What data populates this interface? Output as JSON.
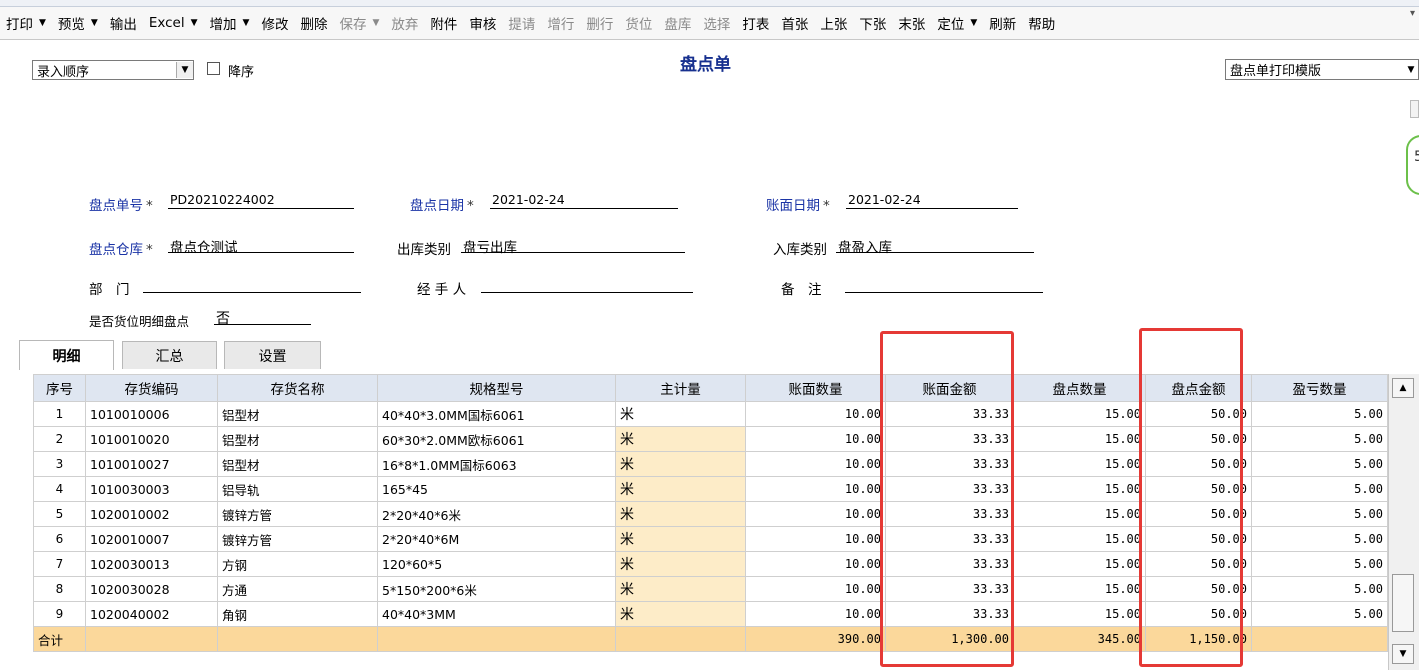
{
  "toolbar": [
    {
      "label": "打印",
      "dropdown": true,
      "disabled": false,
      "name": "print-button"
    },
    {
      "label": "预览",
      "dropdown": true,
      "disabled": false,
      "name": "preview-button"
    },
    {
      "label": "输出",
      "dropdown": false,
      "disabled": false,
      "name": "export-button"
    },
    {
      "label": "Excel",
      "dropdown": true,
      "disabled": false,
      "name": "excel-button"
    },
    {
      "label": "增加",
      "dropdown": true,
      "disabled": false,
      "name": "add-button"
    },
    {
      "label": "修改",
      "dropdown": false,
      "disabled": false,
      "name": "edit-button"
    },
    {
      "label": "删除",
      "dropdown": false,
      "disabled": false,
      "name": "delete-button"
    },
    {
      "label": "保存",
      "dropdown": true,
      "disabled": true,
      "name": "save-button"
    },
    {
      "label": "放弃",
      "dropdown": false,
      "disabled": true,
      "name": "discard-button"
    },
    {
      "label": "附件",
      "dropdown": false,
      "disabled": false,
      "name": "attachment-button"
    },
    {
      "label": "审核",
      "dropdown": false,
      "disabled": false,
      "name": "audit-button"
    },
    {
      "label": "提请",
      "dropdown": false,
      "disabled": true,
      "name": "submit-button"
    },
    {
      "label": "增行",
      "dropdown": false,
      "disabled": true,
      "name": "add-row-button"
    },
    {
      "label": "删行",
      "dropdown": false,
      "disabled": true,
      "name": "delete-row-button"
    },
    {
      "label": "货位",
      "dropdown": false,
      "disabled": true,
      "name": "location-button"
    },
    {
      "label": "盘库",
      "dropdown": false,
      "disabled": true,
      "name": "stocktake-button"
    },
    {
      "label": "选择",
      "dropdown": false,
      "disabled": true,
      "name": "select-button"
    },
    {
      "label": "打表",
      "dropdown": false,
      "disabled": false,
      "name": "print-table-button"
    },
    {
      "label": "首张",
      "dropdown": false,
      "disabled": false,
      "name": "first-record-button"
    },
    {
      "label": "上张",
      "dropdown": false,
      "disabled": false,
      "name": "prev-record-button"
    },
    {
      "label": "下张",
      "dropdown": false,
      "disabled": false,
      "name": "next-record-button"
    },
    {
      "label": "末张",
      "dropdown": false,
      "disabled": false,
      "name": "last-record-button"
    },
    {
      "label": "定位",
      "dropdown": true,
      "disabled": false,
      "name": "locate-button"
    },
    {
      "label": "刷新",
      "dropdown": false,
      "disabled": false,
      "name": "refresh-button"
    },
    {
      "label": "帮助",
      "dropdown": false,
      "disabled": false,
      "name": "help-button"
    }
  ],
  "sort": {
    "value": "录入顺序",
    "desc_label": "降序"
  },
  "title": "盘点单",
  "template": "盘点单打印模版",
  "badge_text": "5",
  "fields": {
    "doc_no_label": "盘点单号",
    "doc_no": "PD20210224002",
    "count_date_label": "盘点日期",
    "count_date": "2021-02-24",
    "book_date_label": "账面日期",
    "book_date": "2021-02-24",
    "warehouse_label": "盘点仓库",
    "warehouse": "盘点仓测试",
    "out_type_label": "出库类别",
    "out_type": "盘亏出库",
    "in_type_label": "入库类别",
    "in_type": "盘盈入库",
    "dept_label": "部　门",
    "dept": "",
    "handler_label": "经 手 人",
    "handler": "",
    "remark_label": "备　注",
    "remark": "",
    "location_detail_label": "是否货位明细盘点",
    "location_detail": "否",
    "required_mark": "*"
  },
  "tabs": [
    "明细",
    "汇总",
    "设置"
  ],
  "grid": {
    "columns": [
      "序号",
      "存货编码",
      "存货名称",
      "规格型号",
      "主计量",
      "账面数量",
      "账面金额",
      "盘点数量",
      "盘点金额",
      "盈亏数量"
    ],
    "rows": [
      [
        "1",
        "1010010006",
        "铝型材",
        "40*40*3.0MM国标6061",
        "米",
        "10.00",
        "33.33",
        "15.00",
        "50.00",
        "5.00"
      ],
      [
        "2",
        "1010010020",
        "铝型材",
        "60*30*2.0MM欧标6061",
        "米",
        "10.00",
        "33.33",
        "15.00",
        "50.00",
        "5.00"
      ],
      [
        "3",
        "1010010027",
        "铝型材",
        "16*8*1.0MM国标6063",
        "米",
        "10.00",
        "33.33",
        "15.00",
        "50.00",
        "5.00"
      ],
      [
        "4",
        "1010030003",
        "铝导轨",
        "165*45",
        "米",
        "10.00",
        "33.33",
        "15.00",
        "50.00",
        "5.00"
      ],
      [
        "5",
        "1020010002",
        "镀锌方管",
        "2*20*40*6米",
        "米",
        "10.00",
        "33.33",
        "15.00",
        "50.00",
        "5.00"
      ],
      [
        "6",
        "1020010007",
        "镀锌方管",
        "2*20*40*6M",
        "米",
        "10.00",
        "33.33",
        "15.00",
        "50.00",
        "5.00"
      ],
      [
        "7",
        "1020030013",
        "方钢",
        "120*60*5",
        "米",
        "10.00",
        "33.33",
        "15.00",
        "50.00",
        "5.00"
      ],
      [
        "8",
        "1020030028",
        "方通",
        "5*150*200*6米",
        "米",
        "10.00",
        "33.33",
        "15.00",
        "50.00",
        "5.00"
      ],
      [
        "9",
        "1020040002",
        "角钢",
        "40*40*3MM",
        "米",
        "10.00",
        "33.33",
        "15.00",
        "50.00",
        "5.00"
      ]
    ],
    "total": [
      "合计",
      "",
      "",
      "",
      "",
      "390.00",
      "1,300.00",
      "345.00",
      "1,150.00",
      ""
    ]
  },
  "highlight_color": "#e53935",
  "total_row_color": "#fbd89b",
  "unit_cell_color": "#fdecc8"
}
